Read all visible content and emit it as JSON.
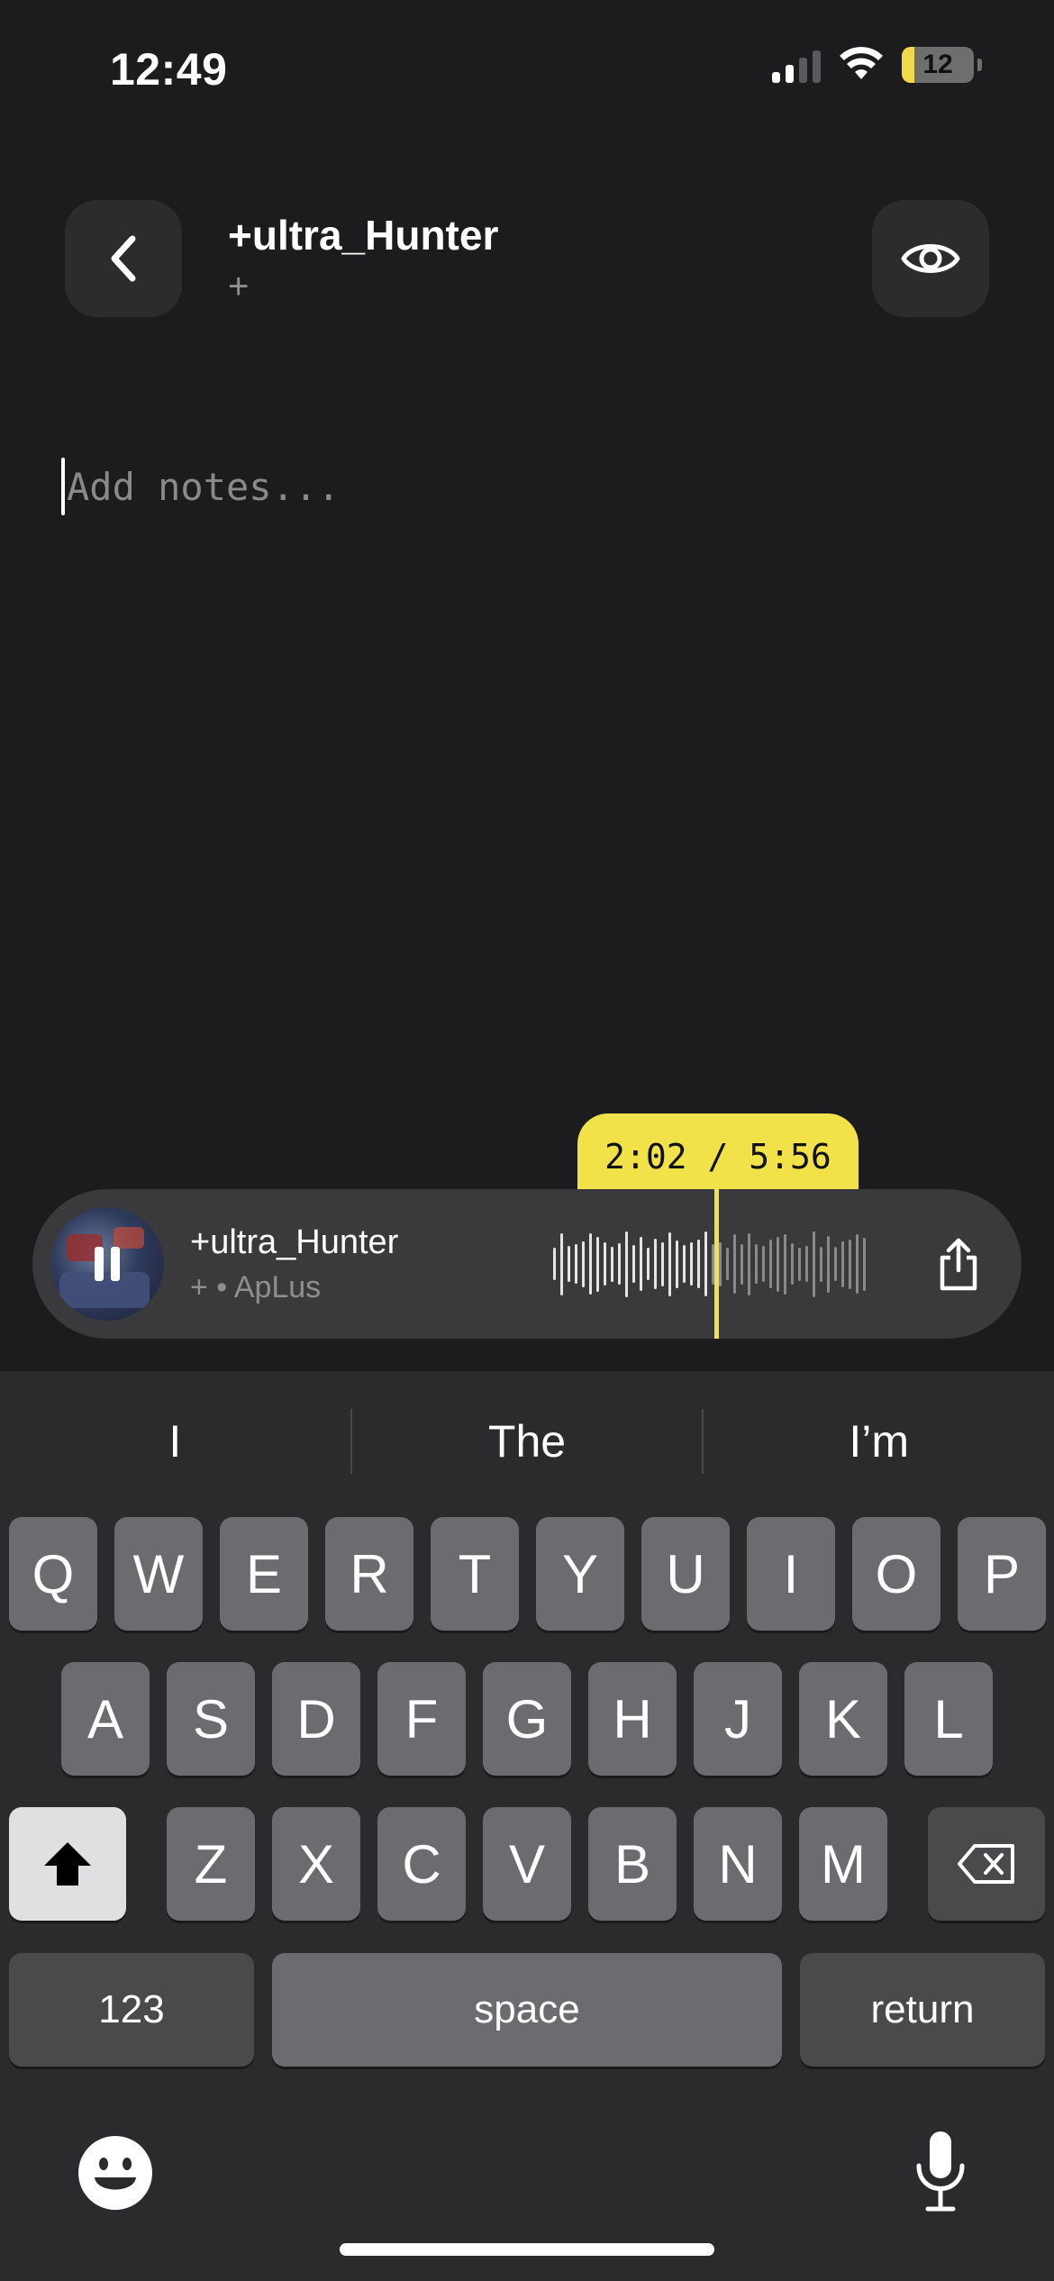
{
  "status_bar": {
    "time": "12:49",
    "battery": "12"
  },
  "header": {
    "title": "+ultra_Hunter",
    "subtitle": "+"
  },
  "notes": {
    "placeholder": "Add notes..."
  },
  "player": {
    "time_display": "2:02 / 5:56",
    "track_title": "+ultra_Hunter",
    "track_subtitle": "+ • ApLus",
    "progress": 0.3427,
    "accent_color": "#f2e24a"
  },
  "keyboard": {
    "suggestions": [
      "I",
      "The",
      "I’m"
    ],
    "row1": [
      "Q",
      "W",
      "E",
      "R",
      "T",
      "Y",
      "U",
      "I",
      "O",
      "P"
    ],
    "row2": [
      "A",
      "S",
      "D",
      "F",
      "G",
      "H",
      "J",
      "K",
      "L"
    ],
    "row3": [
      "Z",
      "X",
      "C",
      "V",
      "B",
      "N",
      "M"
    ],
    "numbers_label": "123",
    "space_label": "space",
    "return_label": "return"
  },
  "icons": {
    "back": "chevron-left-icon",
    "eye": "eye-icon",
    "share": "share-icon",
    "shift": "shift-icon",
    "delete": "delete-icon",
    "emoji": "emoji-icon",
    "mic": "microphone-icon"
  }
}
